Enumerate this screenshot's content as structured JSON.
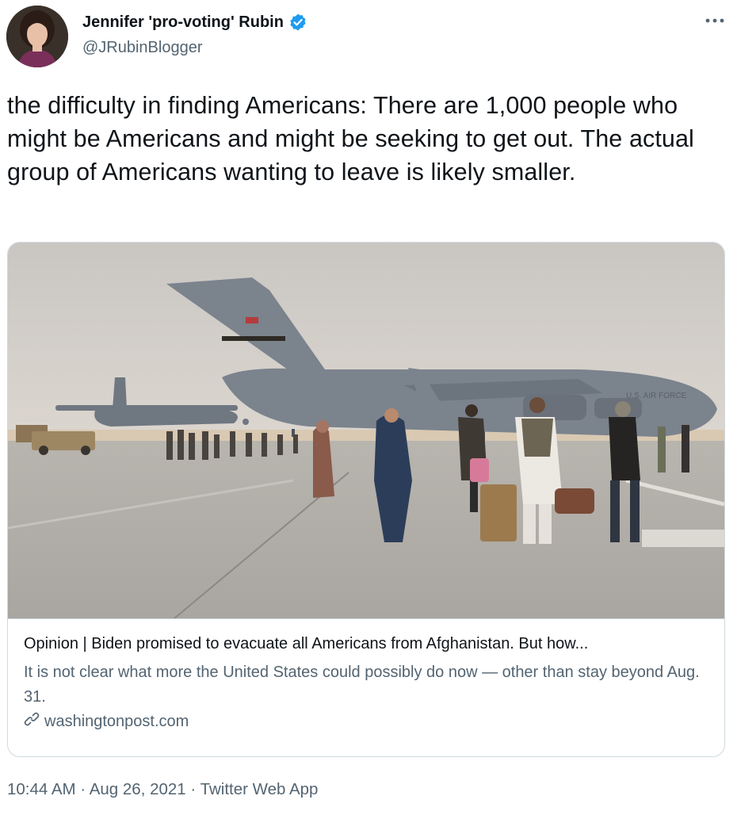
{
  "author": {
    "name": "Jennifer 'pro-voting' Rubin",
    "handle": "@JRubinBlogger",
    "verified_icon": "verified-badge-icon"
  },
  "tweet": {
    "text": "the difficulty in finding Americans: There are 1,000 people who might be Americans and might be seeking to get out. The actual group of Americans wanting to leave is likely smaller."
  },
  "card": {
    "title": "Opinion | Biden promised to evacuate all Americans from Afghanistan. But how...",
    "description": "It is not clear what more the United States could possibly do now — other than stay beyond Aug. 31.",
    "domain": "washingtonpost.com",
    "image_markings": "U.S. AIR FORCE"
  },
  "meta": {
    "time": "10:44 AM",
    "separator": "·",
    "date": "Aug 26, 2021",
    "source": "Twitter Web App"
  },
  "colors": {
    "text": "#0f1419",
    "secondary": "#536471",
    "verified": "#1d9bf0",
    "border": "#cfd9de"
  }
}
